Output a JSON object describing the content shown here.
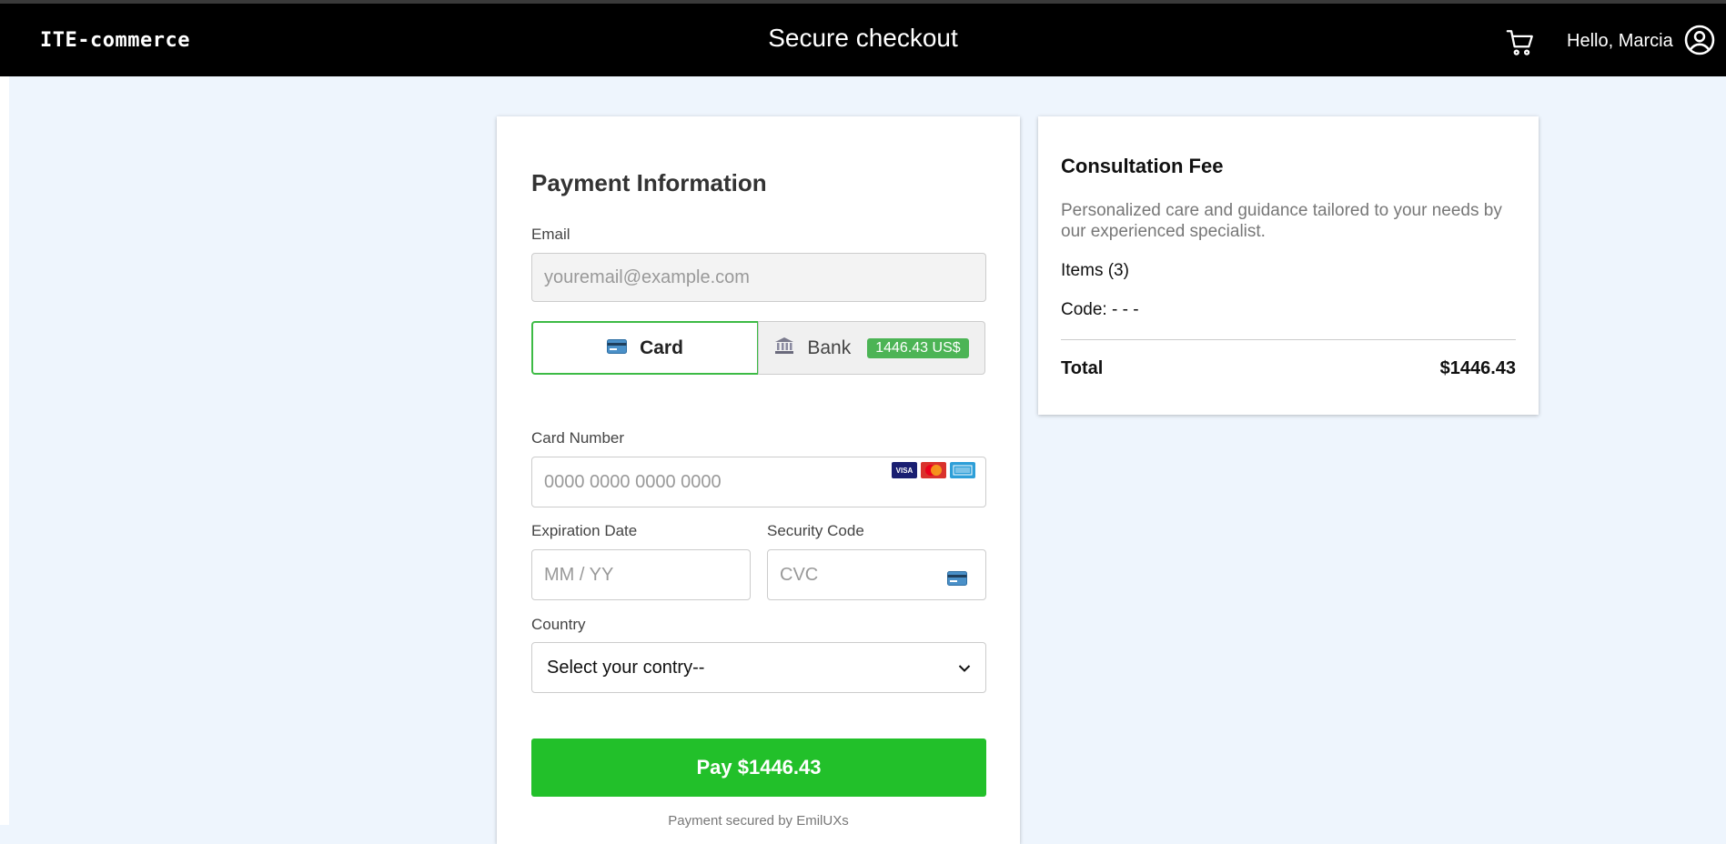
{
  "header": {
    "brand": "ITE-commerce",
    "title": "Secure checkout",
    "greeting": "Hello, Marcia",
    "icons": {
      "cart": "cart-icon",
      "user": "user-circle-icon"
    }
  },
  "payment": {
    "title": "Payment Information",
    "email_label": "Email",
    "email_placeholder": "youremail@example.com",
    "methods": {
      "card_label": "Card",
      "bank_label": "Bank",
      "bank_badge": "1446.43 US$",
      "selected": "Card"
    },
    "card_number_label": "Card Number",
    "card_number_placeholder": "0000 0000 0000 0000",
    "card_brands": [
      "VISA",
      "MC",
      "AMEX"
    ],
    "expiration_label": "Expiration Date",
    "expiration_placeholder": "MM / YY",
    "security_label": "Security Code",
    "security_placeholder": "CVC",
    "country_label": "Country",
    "country_selected": "Select your contry--",
    "pay_button": "Pay $1446.43",
    "secured_text": "Payment secured by EmilUXs"
  },
  "summary": {
    "title": "Consultation Fee",
    "description": "Personalized care and guidance tailored to your needs by our experienced specialist.",
    "items": "Items (3)",
    "code": "Code: - - -",
    "total_label": "Total",
    "total_value": "$1446.43"
  },
  "colors": {
    "accent_green": "#22c02a",
    "badge_green": "#4cb455",
    "header_bg": "#000000",
    "page_bg": "#eef5fd"
  }
}
